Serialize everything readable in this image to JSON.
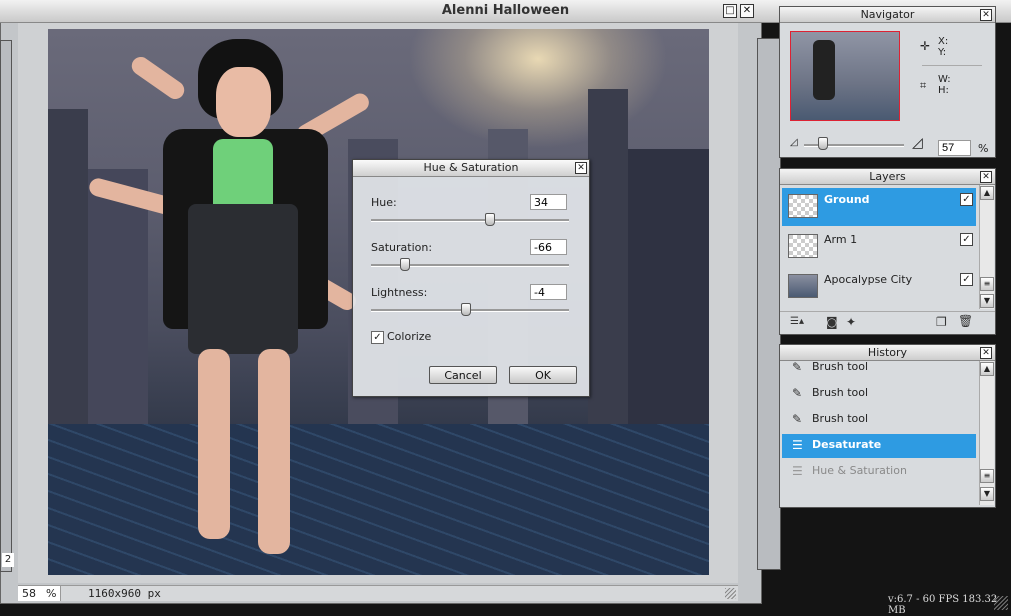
{
  "document": {
    "title": "Alenni Halloween",
    "zoom_value": "58",
    "zoom_unit": "%",
    "size_text": "1160x960 px"
  },
  "background_stub": {
    "number": "2"
  },
  "hue_saturation": {
    "title": "Hue & Saturation",
    "hue_label": "Hue:",
    "hue_value": "34",
    "hue_slider_fraction": 0.6,
    "saturation_label": "Saturation:",
    "saturation_value": "-66",
    "saturation_slider_fraction": 0.17,
    "lightness_label": "Lightness:",
    "lightness_value": "-4",
    "lightness_slider_fraction": 0.48,
    "colorize_label": "Colorize",
    "colorize_checked": true,
    "cancel_label": "Cancel",
    "ok_label": "OK"
  },
  "navigator": {
    "title": "Navigator",
    "x_label": "X:",
    "y_label": "Y:",
    "w_label": "W:",
    "h_label": "H:",
    "zoom_value": "57",
    "zoom_unit": "%"
  },
  "layers": {
    "title": "Layers",
    "items": [
      {
        "name": "Ground",
        "visible": true,
        "selected": true
      },
      {
        "name": "Arm 1",
        "visible": true,
        "selected": false
      },
      {
        "name": "Apocalypse City",
        "visible": true,
        "selected": false
      }
    ]
  },
  "history": {
    "title": "History",
    "items": [
      {
        "label": "Brush tool"
      },
      {
        "label": "Brush tool"
      },
      {
        "label": "Brush tool"
      },
      {
        "label": "Desaturate"
      },
      {
        "label": "Hue & Saturation"
      }
    ]
  },
  "status": {
    "fps_text": "v:6.7 - 60 FPS 183.32 MB"
  },
  "colors": {
    "selection": "#2e9be2",
    "thumb_border": "#dd2233"
  }
}
